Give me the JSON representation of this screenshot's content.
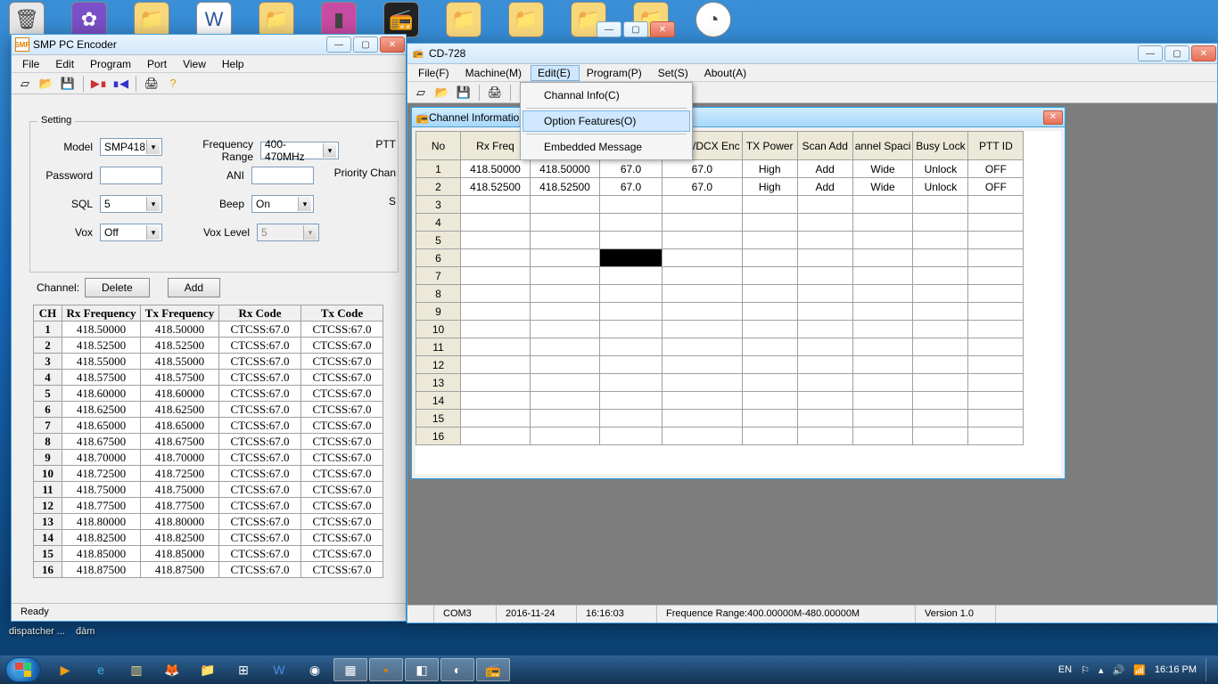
{
  "smp": {
    "title": "SMP PC Encoder",
    "menus": [
      "File",
      "Edit",
      "Program",
      "Port",
      "View",
      "Help"
    ],
    "settingLegend": "Setting",
    "labels": {
      "model": "Model",
      "freqRange": "Frequency Range",
      "ptt": "PTT",
      "password": "Password",
      "ani": "ANI",
      "priority": "Priority Chan",
      "sql": "SQL",
      "beep": "Beep",
      "s": "S",
      "vox": "Vox",
      "voxLevel": "Vox Level",
      "channel": "Channel:",
      "delete": "Delete",
      "add": "Add"
    },
    "values": {
      "model": "SMP418",
      "freqRange": "400-470MHz",
      "sql": "5",
      "beep": "On",
      "vox": "Off",
      "voxLevel": "5",
      "password": "",
      "ani": ""
    },
    "table": {
      "cols": [
        "CH",
        "Rx Frequency",
        "Tx Frequency",
        "Rx Code",
        "Tx Code"
      ],
      "rows": [
        [
          "1",
          "418.50000",
          "418.50000",
          "CTCSS:67.0",
          "CTCSS:67.0"
        ],
        [
          "2",
          "418.52500",
          "418.52500",
          "CTCSS:67.0",
          "CTCSS:67.0"
        ],
        [
          "3",
          "418.55000",
          "418.55000",
          "CTCSS:67.0",
          "CTCSS:67.0"
        ],
        [
          "4",
          "418.57500",
          "418.57500",
          "CTCSS:67.0",
          "CTCSS:67.0"
        ],
        [
          "5",
          "418.60000",
          "418.60000",
          "CTCSS:67.0",
          "CTCSS:67.0"
        ],
        [
          "6",
          "418.62500",
          "418.62500",
          "CTCSS:67.0",
          "CTCSS:67.0"
        ],
        [
          "7",
          "418.65000",
          "418.65000",
          "CTCSS:67.0",
          "CTCSS:67.0"
        ],
        [
          "8",
          "418.67500",
          "418.67500",
          "CTCSS:67.0",
          "CTCSS:67.0"
        ],
        [
          "9",
          "418.70000",
          "418.70000",
          "CTCSS:67.0",
          "CTCSS:67.0"
        ],
        [
          "10",
          "418.72500",
          "418.72500",
          "CTCSS:67.0",
          "CTCSS:67.0"
        ],
        [
          "11",
          "418.75000",
          "418.75000",
          "CTCSS:67.0",
          "CTCSS:67.0"
        ],
        [
          "12",
          "418.77500",
          "418.77500",
          "CTCSS:67.0",
          "CTCSS:67.0"
        ],
        [
          "13",
          "418.80000",
          "418.80000",
          "CTCSS:67.0",
          "CTCSS:67.0"
        ],
        [
          "14",
          "418.82500",
          "418.82500",
          "CTCSS:67.0",
          "CTCSS:67.0"
        ],
        [
          "15",
          "418.85000",
          "418.85000",
          "CTCSS:67.0",
          "CTCSS:67.0"
        ],
        [
          "16",
          "418.87500",
          "418.87500",
          "CTCSS:67.0",
          "CTCSS:67.0"
        ]
      ]
    },
    "status": "Ready"
  },
  "cd": {
    "title": "CD-728",
    "menus": [
      "File(F)",
      "Machine(M)",
      "Edit(E)",
      "Program(P)",
      "Set(S)",
      "About(A)"
    ],
    "openMenuIndex": 2,
    "dropdown": {
      "items": [
        "Channal Info(C)",
        "Option Features(O)",
        "Embedded Message"
      ],
      "hoverIndex": 1
    },
    "innerTitle": "Channel Information",
    "table": {
      "cols": [
        "No",
        "Rx Freq",
        "",
        "",
        "TCSS/DCX Enc",
        "TX Power",
        "Scan Add",
        "annel Spaci",
        "Busy Lock",
        "PTT ID"
      ],
      "rows": [
        [
          "1",
          "418.50000",
          "418.50000",
          "67.0",
          "67.0",
          "High",
          "Add",
          "Wide",
          "Unlock",
          "OFF"
        ],
        [
          "2",
          "418.52500",
          "418.52500",
          "67.0",
          "67.0",
          "High",
          "Add",
          "Wide",
          "Unlock",
          "OFF"
        ],
        [
          "3",
          "",
          "",
          "",
          "",
          "",
          "",
          "",
          "",
          ""
        ],
        [
          "4",
          "",
          "",
          "",
          "",
          "",
          "",
          "",
          "",
          ""
        ],
        [
          "5",
          "",
          "",
          "",
          "",
          "",
          "",
          "",
          "",
          ""
        ],
        [
          "6",
          "",
          "",
          "",
          "",
          "",
          "",
          "",
          "",
          ""
        ],
        [
          "7",
          "",
          "",
          "",
          "",
          "",
          "",
          "",
          "",
          ""
        ],
        [
          "8",
          "",
          "",
          "",
          "",
          "",
          "",
          "",
          "",
          ""
        ],
        [
          "9",
          "",
          "",
          "",
          "",
          "",
          "",
          "",
          "",
          ""
        ],
        [
          "10",
          "",
          "",
          "",
          "",
          "",
          "",
          "",
          "",
          ""
        ],
        [
          "11",
          "",
          "",
          "",
          "",
          "",
          "",
          "",
          "",
          ""
        ],
        [
          "12",
          "",
          "",
          "",
          "",
          "",
          "",
          "",
          "",
          ""
        ],
        [
          "13",
          "",
          "",
          "",
          "",
          "",
          "",
          "",
          "",
          ""
        ],
        [
          "14",
          "",
          "",
          "",
          "",
          "",
          "",
          "",
          "",
          ""
        ],
        [
          "15",
          "",
          "",
          "",
          "",
          "",
          "",
          "",
          "",
          ""
        ],
        [
          "16",
          "",
          "",
          "",
          "",
          "",
          "",
          "",
          "",
          ""
        ]
      ],
      "selectedCell": {
        "row": 5,
        "col": 3
      }
    },
    "status": {
      "port": "COM3",
      "date": "2016-11-24",
      "time": "16:16:03",
      "range": "Frequence Range:400.00000M-480.00000M",
      "ver": "Version 1.0"
    }
  },
  "taskbar": {
    "labels": [
      "dispatcher ...",
      "đàm"
    ],
    "lang": "EN",
    "clock": "16:16 PM"
  }
}
